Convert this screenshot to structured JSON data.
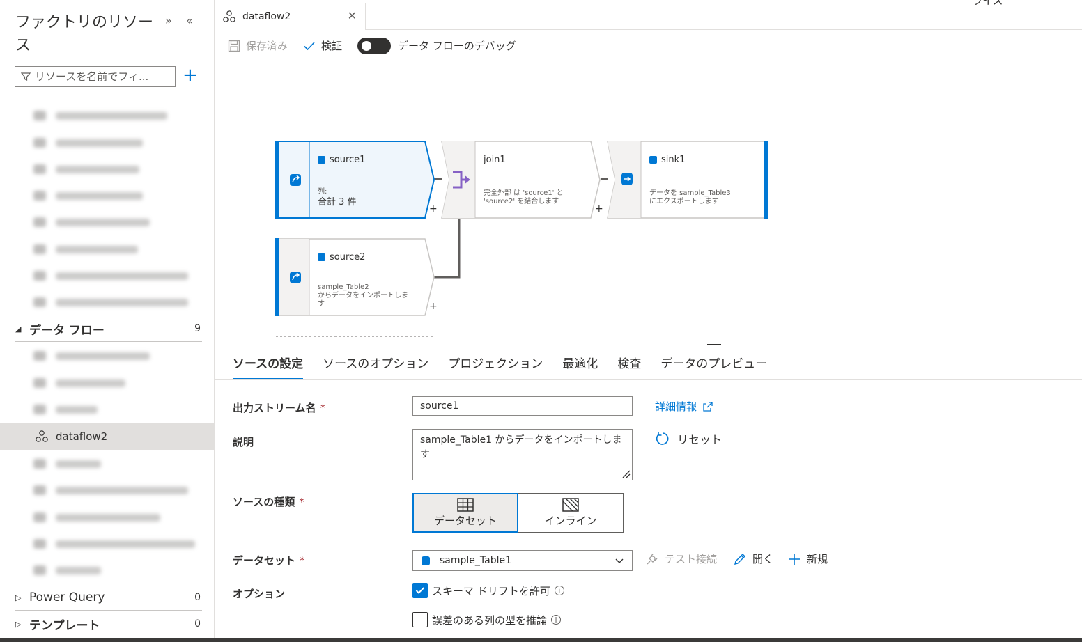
{
  "sidebar": {
    "title": "ファクトリのリソース",
    "filter_placeholder": "リソースを名前でフィ...",
    "sections": [
      {
        "label": "データ フロー",
        "count": "9"
      },
      {
        "label": "Power Query",
        "count": "0"
      },
      {
        "label": "テンプレート",
        "count": "0"
      }
    ],
    "selected_item": "dataflow2"
  },
  "header": {
    "corner_text": "ライス",
    "tab_label": "dataflow2",
    "toolbar": {
      "saved_label": "保存済み",
      "validate_label": "検証",
      "debug_label": "データ フローのデバッグ"
    }
  },
  "canvas": {
    "nodes": {
      "source1": {
        "title": "source1",
        "desc1": "列:",
        "desc2": "合計 3 件"
      },
      "join1": {
        "title": "join1",
        "desc1": "完全外部 は 'source1' と",
        "desc2": "'source2' を結合します"
      },
      "sink1": {
        "title": "sink1",
        "desc1": "データを sample_Table3",
        "desc2": "にエクスポートします"
      },
      "source2": {
        "title": "source2",
        "desc1": "sample_Table2",
        "desc2": "からデータをインポートしま",
        "desc3": "す"
      }
    },
    "plus": "+"
  },
  "config": {
    "tabs": [
      "ソースの設定",
      "ソースのオプション",
      "プロジェクション",
      "最適化",
      "検査",
      "データのプレビュー"
    ],
    "output_stream": {
      "label": "出力ストリーム名",
      "value": "source1",
      "learn_more": "詳細情報"
    },
    "description": {
      "label": "説明",
      "value": "sample_Table1 からデータをインポートします",
      "reset": "リセット"
    },
    "source_type": {
      "label": "ソースの種類",
      "options": [
        "データセット",
        "インライン"
      ],
      "selected": "データセット"
    },
    "dataset": {
      "label": "データセット",
      "value": "sample_Table1",
      "test_connection": "テスト接続",
      "open": "開く",
      "new": "新規"
    },
    "options": {
      "label": "オプション",
      "allow_schema_drift": "スキーマ ドリフトを許可",
      "infer_drifted_types": "誤差のある列の型を推論"
    },
    "required_mark": "*"
  },
  "colors": {
    "accent": "#0078d4",
    "join": "#8661c5"
  }
}
